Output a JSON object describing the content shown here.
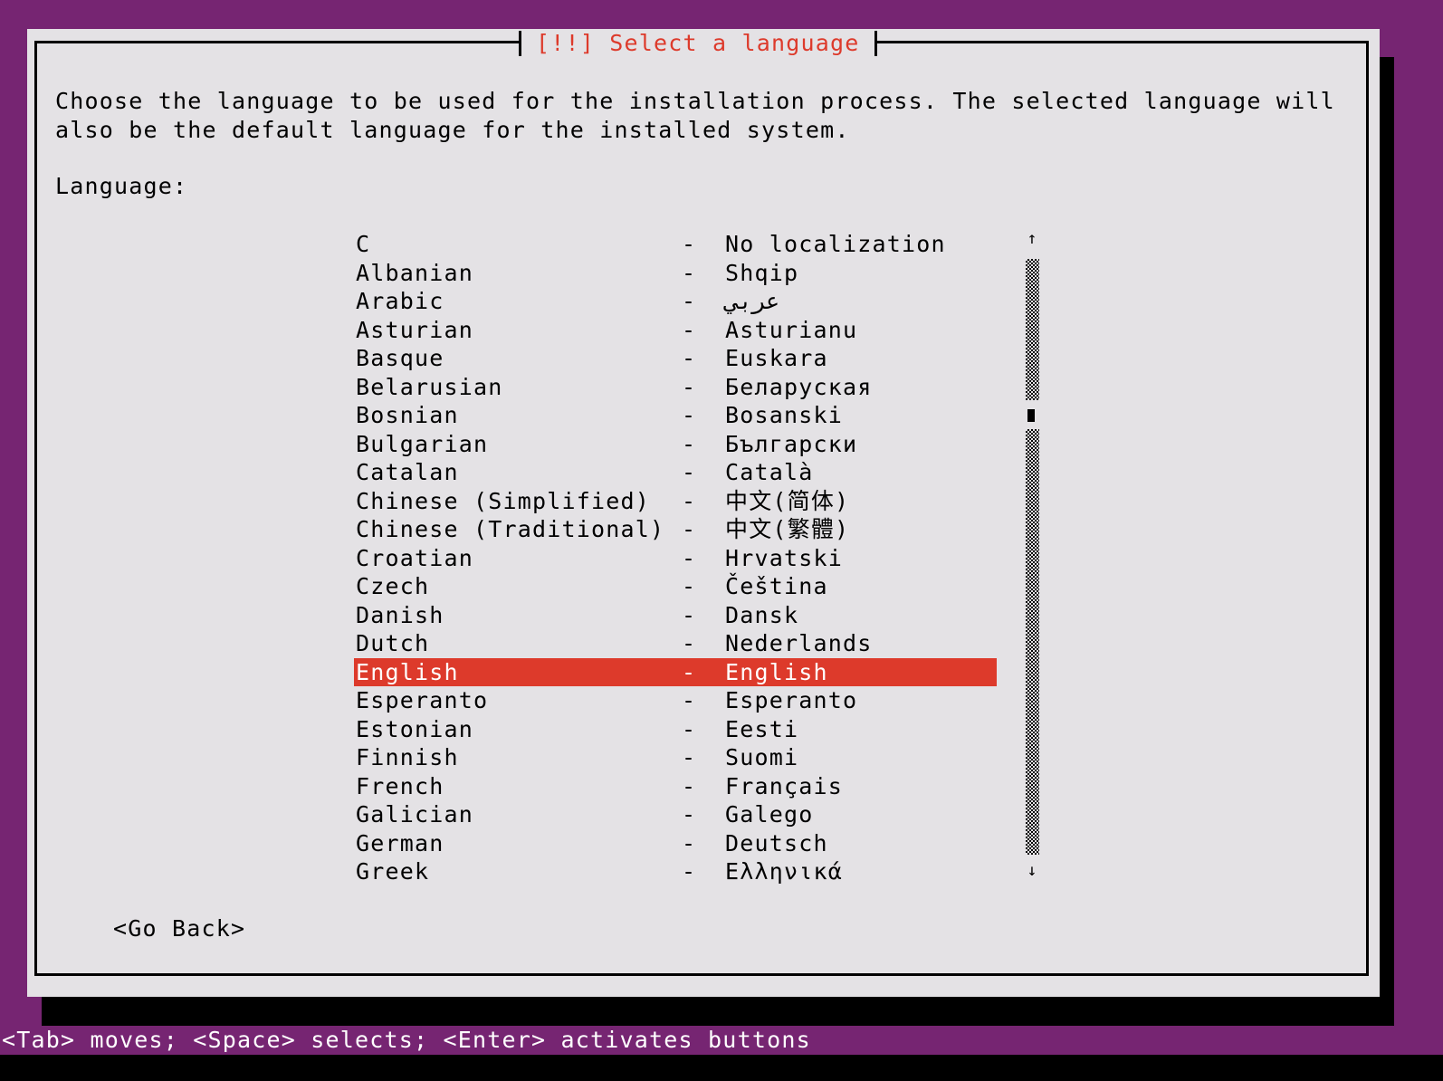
{
  "dialog": {
    "title": "[!!] Select a language",
    "description_lines": [
      "Choose the language to be used for the installation process. The selected language will",
      "also be the default language for the installed system."
    ],
    "field_label": "Language:",
    "go_back_label": "<Go Back>"
  },
  "languages": [
    {
      "name": "C",
      "native": "No localization"
    },
    {
      "name": "Albanian",
      "native": "Shqip"
    },
    {
      "name": "Arabic",
      "native": "عربي"
    },
    {
      "name": "Asturian",
      "native": "Asturianu"
    },
    {
      "name": "Basque",
      "native": "Euskara"
    },
    {
      "name": "Belarusian",
      "native": "Беларуская"
    },
    {
      "name": "Bosnian",
      "native": "Bosanski"
    },
    {
      "name": "Bulgarian",
      "native": "Български"
    },
    {
      "name": "Catalan",
      "native": "Català"
    },
    {
      "name": "Chinese (Simplified)",
      "native": "中文(简体)"
    },
    {
      "name": "Chinese (Traditional)",
      "native": "中文(繁體)"
    },
    {
      "name": "Croatian",
      "native": "Hrvatski"
    },
    {
      "name": "Czech",
      "native": "Čeština"
    },
    {
      "name": "Danish",
      "native": "Dansk"
    },
    {
      "name": "Dutch",
      "native": "Nederlands"
    },
    {
      "name": "English",
      "native": "English"
    },
    {
      "name": "Esperanto",
      "native": "Esperanto"
    },
    {
      "name": "Estonian",
      "native": "Eesti"
    },
    {
      "name": "Finnish",
      "native": "Suomi"
    },
    {
      "name": "French",
      "native": "Français"
    },
    {
      "name": "Galician",
      "native": "Galego"
    },
    {
      "name": "German",
      "native": "Deutsch"
    },
    {
      "name": "Greek",
      "native": "Ελληνικά"
    }
  ],
  "separator": "-",
  "selected_index": 15,
  "scrollbar": {
    "up_icon": "↑",
    "down_icon": "↓",
    "position_fraction": 0.2
  },
  "status_bar": "<Tab> moves; <Space> selects; <Enter> activates buttons",
  "colors": {
    "background": "#762572",
    "dialog": "#e4e2e5",
    "accent": "#dd3a2b",
    "text": "#000000"
  }
}
